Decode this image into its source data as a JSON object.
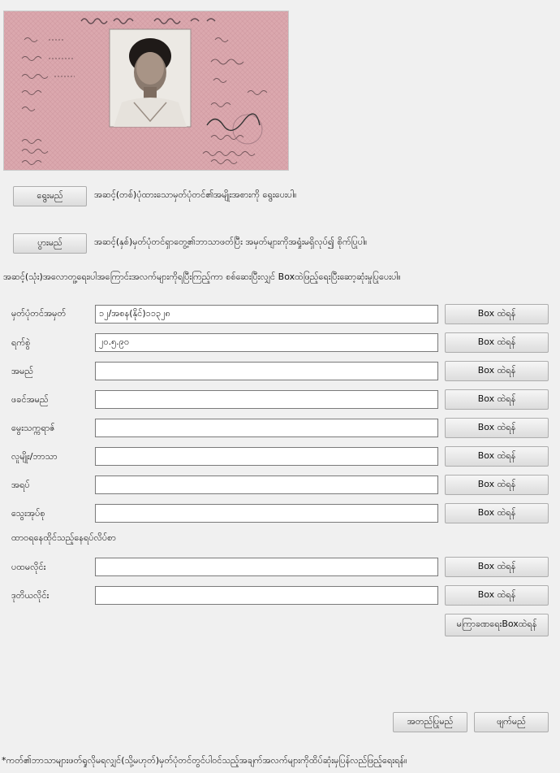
{
  "header_actions": {
    "select_button": "ရွေးမည်",
    "select_instruction": "အဆင့်(တစ်)ပုံထားသောမှတ်ပုံတင်၏အမျိုးအစားကို ရွေးပေးပါ။",
    "scan_button": "ပွားမည်",
    "scan_instruction": "အဆင့်(နှစ်)မှတ်ပုံတင်ရှာတွေ့၏ဘာသာဖတ်ပြီး အမှတ်များကိုအရှုံးမရှိလုပ်၍ စိုက်ပြုပါ။",
    "step3_instruction": "အဆင့်(သုံး)အလောတူ့ရေး၊ပါအကြောင်းအလက်များကိုရပြီးကြည့်ကာ စစ်ဆေးပြီးလျှင် Boxထဲဖြည့်ရေးပြီးဆော့ဆုံးမှုပြုပေးပါ။"
  },
  "fields": [
    {
      "label": "မှတ်ပုံတင်အမှတ်",
      "value": "၁၂/အစန(နိုင်)၁၁၃၂၈",
      "button": "Box ထဲရန်"
    },
    {
      "label": "ရက်စွဲ",
      "value": "၂၀.၅.၉၀",
      "button": "Box ထဲရန်"
    },
    {
      "label": "အမည်",
      "value": "",
      "button": "Box ထဲရန်"
    },
    {
      "label": "ဖခင်အမည်",
      "value": "",
      "button": "Box ထဲရန်"
    },
    {
      "label": "မွေးသက္ကရာဇ်",
      "value": "",
      "button": "Box ထဲရန်"
    },
    {
      "label": "လူမျိုး/ဘာသာ",
      "value": "",
      "button": "Box ထဲရန်"
    },
    {
      "label": "အရပ်",
      "value": "",
      "button": "Box ထဲရန်"
    },
    {
      "label": "သွေးအုပ်စု",
      "value": "",
      "button": "Box ထဲရန်"
    }
  ],
  "address": {
    "heading": "ထာဝရနေထိုင်သည့်နေရပ်လိပ်စာ",
    "fields": [
      {
        "label": "ပထမလိုင်း",
        "value": "",
        "button": "Box ထဲရန်"
      },
      {
        "label": "ဒုတိယလိုင်း",
        "value": "",
        "button": "Box ထဲရန်"
      }
    ]
  },
  "fill_all_button": "မကြာခဏရေးBoxထဲရန်",
  "footer": {
    "confirm_button": "အတည်ပြုမည်",
    "cancel_button": "ဖျက်မည်",
    "note": "*ကတ်၏ဘာသာများဖတ်ရှုလိုမရလျှင်(သို့မဟုတ်)မှတ်ပုံတင်တွင်ပါဝင်သည့်အချက်အလက်များကိုထိပ်ဆုံးမှပြန်လည်ဖြည့်ရေးရန်။"
  },
  "colors": {
    "card_pink": "#d9a3a8",
    "card_text": "#4a3a3f",
    "window_bg": "#f0f0f0"
  }
}
